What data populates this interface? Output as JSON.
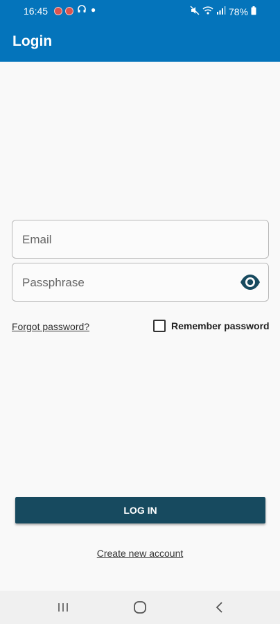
{
  "status_bar": {
    "time": "16:45",
    "battery": "78%",
    "icons": [
      "notification-dot-icon",
      "notification-dot-icon",
      "headphones-icon",
      "dot-icon",
      "mute-icon",
      "wifi-icon",
      "signal-icon",
      "battery-icon"
    ]
  },
  "app_bar": {
    "title": "Login"
  },
  "form": {
    "email": {
      "placeholder": "Email",
      "value": ""
    },
    "password": {
      "placeholder": "Passphrase",
      "value": "",
      "visibility_icon": "eye-icon"
    },
    "forgot_password": "Forgot password?",
    "remember_password": {
      "label": "Remember password",
      "checked": false
    },
    "login_button": "LOG IN",
    "create_account": "Create new account"
  },
  "nav_bar": {
    "buttons": [
      "recent-apps-icon",
      "home-icon",
      "back-icon"
    ]
  },
  "colors": {
    "primary": "#0474bb",
    "button": "#174a5f",
    "eye_icon": "#174a5f",
    "background": "#f9f9f9"
  }
}
